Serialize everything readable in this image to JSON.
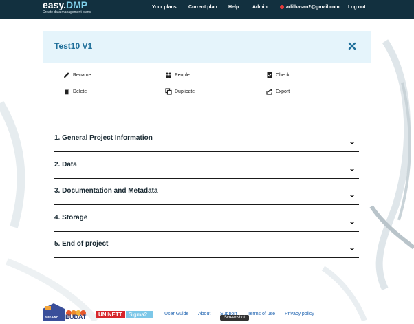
{
  "brand": {
    "name_main": "easy.",
    "name_accent": "DMP",
    "tagline": "Create data management plans"
  },
  "nav": {
    "your_plans": "Your plans",
    "current_plan": "Current plan",
    "help": "Help",
    "admin": "Admin",
    "user_email": "adilhasan2@gmail.com",
    "logout": "Log out"
  },
  "plan": {
    "title": "Test10 V1"
  },
  "actions": {
    "rename": "Rename",
    "people": "People",
    "check": "Check",
    "delete": "Delete",
    "duplicate": "Duplicate",
    "export": "Export"
  },
  "sections": [
    "1. General Project Information",
    "2. Data",
    "3. Documentation and Metadata",
    "4. Storage",
    "5. End of project"
  ],
  "footer": {
    "logo_easydmp": "easy. DMP",
    "logo_eudat": "EUDAT",
    "logo_uninett": "UNINETT",
    "logo_sigma2": "Sigma2",
    "links": {
      "user_guide": "User Guide",
      "about": "About",
      "support": "Support",
      "terms": "Terms of use",
      "privacy": "Privacy policy"
    },
    "screenshot_label": "Screenshot"
  },
  "colors": {
    "topbar": "#12303f",
    "title_panel": "#e5f4fb",
    "title_text": "#1f6f9a",
    "link": "#1d62b0"
  }
}
